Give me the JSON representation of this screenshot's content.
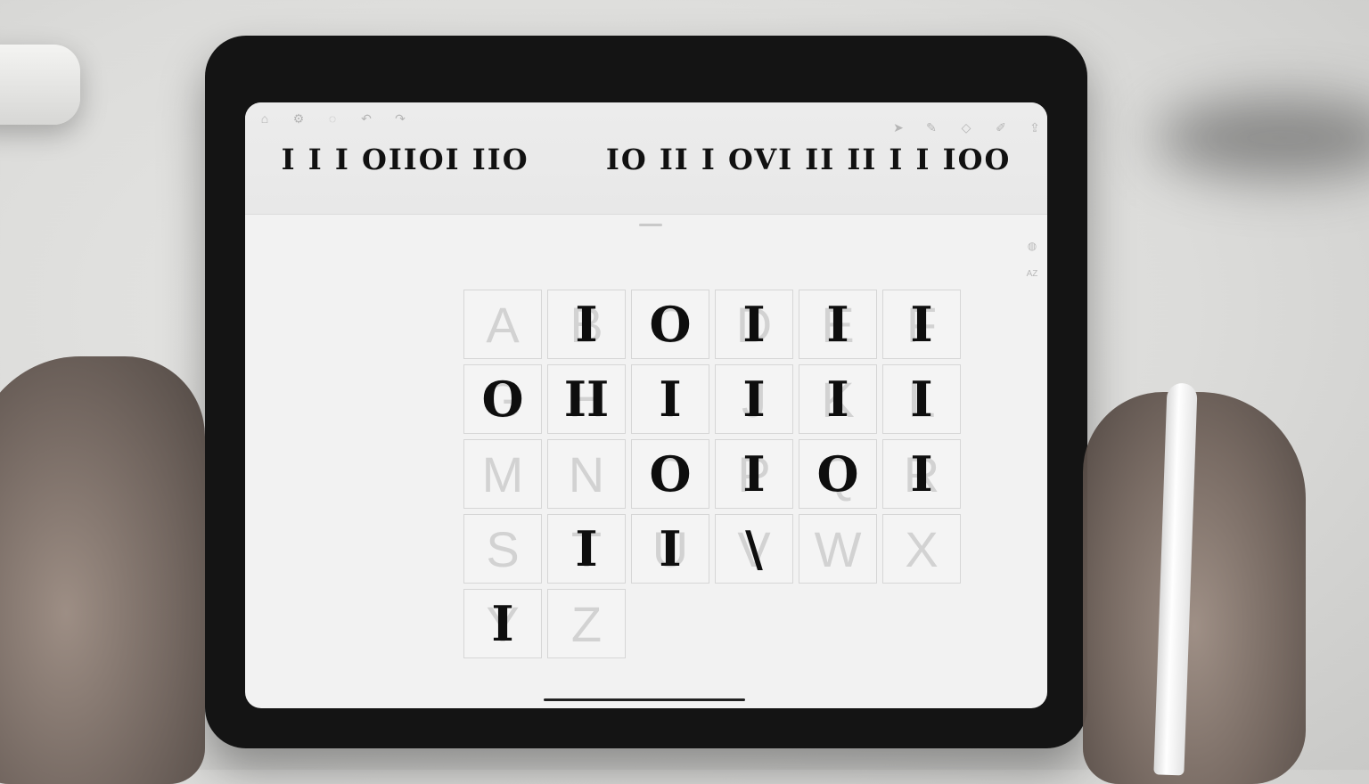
{
  "toolbar": {
    "left_icons": [
      "home-icon",
      "settings-icon",
      "comment-icon",
      "undo-icon",
      "redo-icon"
    ],
    "right_icons": [
      "select-arrow-icon",
      "pen-icon",
      "eraser-icon",
      "edit-icon",
      "share-icon"
    ]
  },
  "preview_text": "I I I OIIOI IIO",
  "preview_text_2": "IO II I OVI II II I I IOO",
  "side_tools": [
    "globe-icon",
    "AZ"
  ],
  "grid": {
    "cells": [
      {
        "letter": "A",
        "glyph": ""
      },
      {
        "letter": "B",
        "glyph": "I"
      },
      {
        "letter": "C",
        "glyph": "O"
      },
      {
        "letter": "D",
        "glyph": "I"
      },
      {
        "letter": "E",
        "glyph": "I"
      },
      {
        "letter": "F",
        "glyph": "I"
      },
      {
        "letter": "G",
        "glyph": "O"
      },
      {
        "letter": "H",
        "glyph": "II"
      },
      {
        "letter": "I",
        "glyph": "I"
      },
      {
        "letter": "J",
        "glyph": "I"
      },
      {
        "letter": "K",
        "glyph": "I"
      },
      {
        "letter": "L",
        "glyph": "I"
      },
      {
        "letter": "M",
        "glyph": ""
      },
      {
        "letter": "N",
        "glyph": ""
      },
      {
        "letter": "O",
        "glyph": "O"
      },
      {
        "letter": "P",
        "glyph": "I"
      },
      {
        "letter": "Q",
        "glyph": "O"
      },
      {
        "letter": "R",
        "glyph": "I"
      },
      {
        "letter": "S",
        "glyph": ""
      },
      {
        "letter": "T",
        "glyph": "I"
      },
      {
        "letter": "U",
        "glyph": "I"
      },
      {
        "letter": "V",
        "glyph": "\\"
      },
      {
        "letter": "W",
        "glyph": ""
      },
      {
        "letter": "X",
        "glyph": ""
      },
      {
        "letter": "Y",
        "glyph": "I"
      },
      {
        "letter": "Z",
        "glyph": ""
      }
    ]
  }
}
